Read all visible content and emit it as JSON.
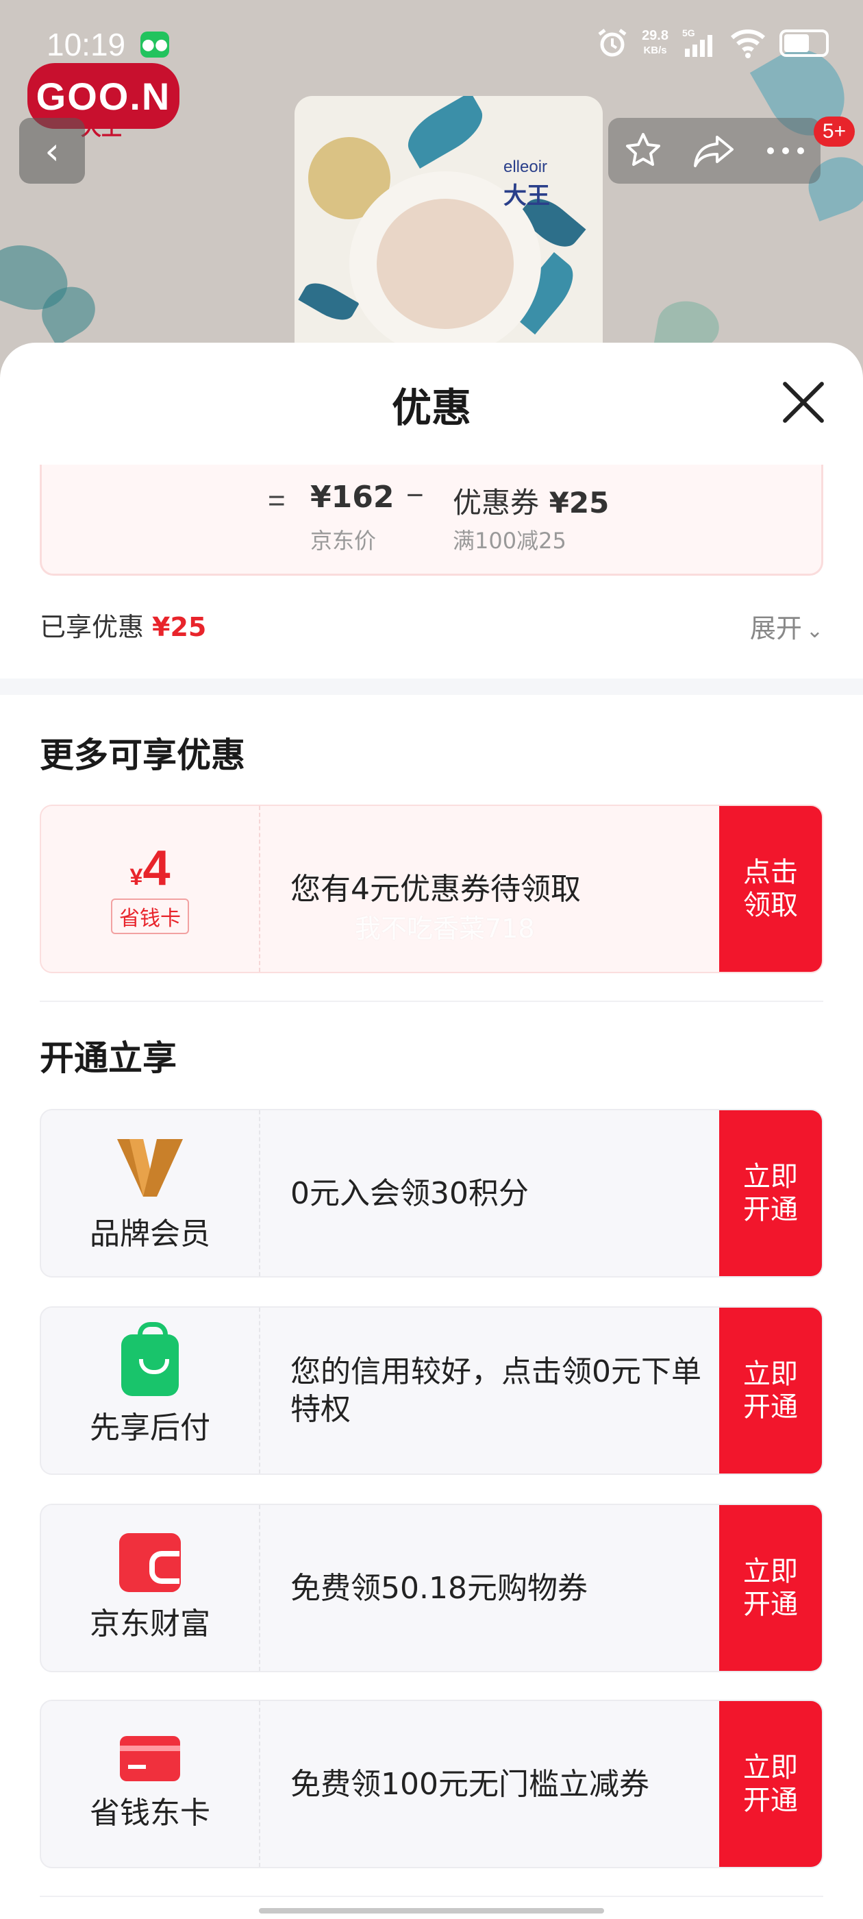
{
  "status_bar": {
    "time": "10:19",
    "network_speed": "29.8",
    "speed_unit": "KB/s",
    "net_type": "5G"
  },
  "product": {
    "brand_logo": "GOO.N",
    "brand_sub": "大王",
    "pack_brand": "elleoir",
    "pack_brand_cn": "大王"
  },
  "nav": {
    "back_icon": "‹",
    "cart_badge": "5+"
  },
  "sheet": {
    "title": "优惠",
    "calc": {
      "equals": "=",
      "price": "¥162",
      "price_label": "京东价",
      "minus": "−",
      "coupon_name": "优惠券",
      "coupon_value": "¥25",
      "coupon_rule": "满100减25"
    },
    "enjoyed_label": "已享优惠",
    "enjoyed_value": "¥25",
    "expand_label": "展开",
    "more_title": "更多可享优惠",
    "coupon_card": {
      "currency": "¥",
      "amount": "4",
      "tag": "省钱卡",
      "text": "您有4元优惠券待领取",
      "button": "点击领取",
      "watermark": "我不吃香菜718"
    },
    "open_title": "开通立享",
    "offers": [
      {
        "name": "品牌会员",
        "text": "0元入会领30积分",
        "button": "立即开通"
      },
      {
        "name": "先享后付",
        "text": "您的信用较好，点击领0元下单特权",
        "button": "立即开通"
      },
      {
        "name": "京东财富",
        "text": "免费领50.18元购物券",
        "button": "立即开通"
      },
      {
        "name": "省钱东卡",
        "text": "免费领100元无门槛立减券",
        "button": "立即开通"
      }
    ]
  },
  "colors": {
    "accent_red": "#f2162c",
    "price_red": "#e8242b",
    "member_gold": "#c9802a",
    "paylater_green": "#19c46b"
  }
}
